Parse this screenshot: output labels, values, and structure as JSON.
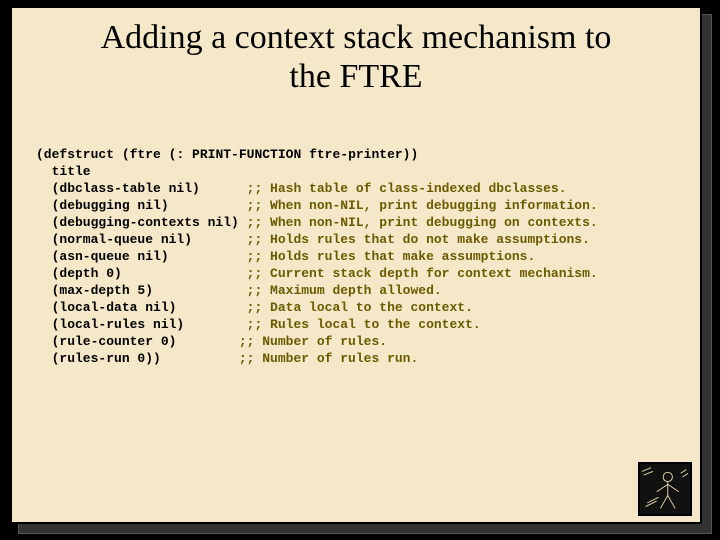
{
  "title_line1": "Adding a context stack mechanism to",
  "title_line2": "the FTRE",
  "code": {
    "l1a": "(defstruct (",
    "l1b": "ftre",
    "l1c": " (: PRINT-FUNCTION ftre-printer))",
    "l2": "  title",
    "l3a": "  (dbclass-table nil)      ",
    "l3b": ";; Hash table of class-indexed dbclasses.",
    "l4a": "  (debugging nil)          ",
    "l4b": ";; When non-NIL, print debugging information.",
    "l5a": "  (debugging-contexts nil) ",
    "l5b": ";; When non-NIL, print debugging on contexts.",
    "l6a": "  (normal-queue nil)       ",
    "l6b": ";; Holds rules that do not make assumptions.",
    "l7a": "  (asn-queue nil)          ",
    "l7b": ";; Holds rules that make assumptions.",
    "l8a": "  (depth 0)                ",
    "l8b": ";; Current stack depth for context mechanism.",
    "l9a": "  (max-depth 5)            ",
    "l9b": ";; Maximum depth allowed.",
    "l10a": "  (local-data nil)         ",
    "l10b": ";; Data local to the context.",
    "l11a": "  (local-rules nil)        ",
    "l11b": ";; Rules local to the context.",
    "l12a": "  (rule-counter 0)        ",
    "l12b": ";; Number of rules.",
    "l13a": "  (rules-run 0))          ",
    "l13b": ";; Number of rules run."
  }
}
